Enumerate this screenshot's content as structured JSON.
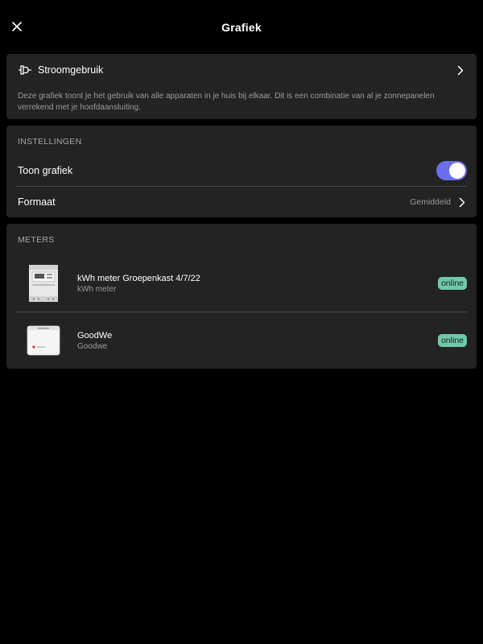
{
  "header": {
    "title": "Grafiek",
    "close_icon": "close-icon"
  },
  "source": {
    "label": "Stroomgebruik",
    "icon": "plug-icon",
    "description": "Deze grafiek toont je het gebruik van alle apparaten in je huis bij elkaar. Dit is een combinatie van al je zonnepanelen verrekend met je hoofdaansluiting."
  },
  "settings": {
    "section_title": "INSTELLINGEN",
    "show_chart_label": "Toon grafiek",
    "show_chart_on": true,
    "format_label": "Formaat",
    "format_value": "Gemiddeld"
  },
  "meters": {
    "section_title": "METERS",
    "items": [
      {
        "name": "kWh meter Groepenkast 4/7/22",
        "type": "kWh meter",
        "status": "online",
        "image": "kwh-meter-image"
      },
      {
        "name": "GoodWe",
        "type": "Goodwe",
        "status": "online",
        "image": "inverter-image"
      }
    ]
  },
  "colors": {
    "background": "#000000",
    "card": "#232323",
    "accent_toggle": "#6a6ee8",
    "online_badge": "#6fcaa9",
    "secondary_text": "#9b9b9b"
  }
}
